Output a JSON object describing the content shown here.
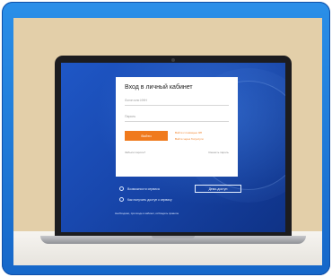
{
  "login": {
    "title": "Вход в личный кабинет",
    "field1_label": "Логин или ИНН",
    "field2_label": "Пароль",
    "button_label": "Войти",
    "side_link1": "Войти с помощью ЭП",
    "side_link2": "Войти через Госуслуги",
    "bottom_link1": "Забыли пароль?",
    "bottom_link2": "Сменить пароль"
  },
  "extras": {
    "item1": "Возможности сервиса",
    "item2": "Как получить доступ к сервису",
    "demo_button": "Демо-доступ",
    "footer": "Необходимо, при входе в кабинет, соблюдать правила"
  }
}
